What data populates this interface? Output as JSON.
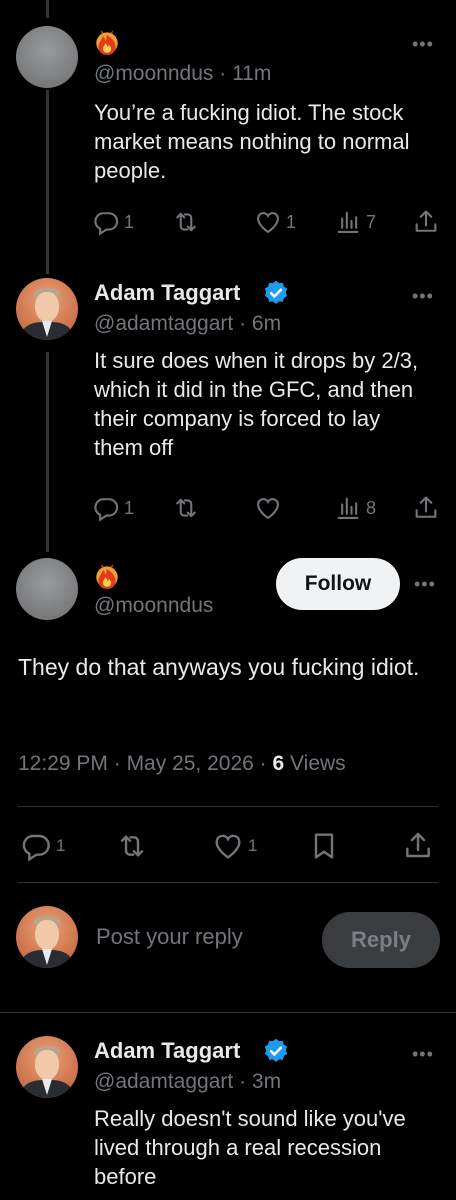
{
  "tweets": [
    {
      "handle": "@moonndus",
      "time": "11m",
      "text": "You’re a fucking idiot. The stock market means nothing to normal people.",
      "replies": "1",
      "retweets": "",
      "likes": "1",
      "views": "7"
    },
    {
      "name": "Adam Taggart",
      "handle": "@adamtaggart",
      "time": "6m",
      "text": "It sure does when it drops by 2/3, which it did in the GFC, and then their company is forced to lay them off",
      "replies": "1",
      "retweets": "",
      "likes": "",
      "views": "8"
    }
  ],
  "focus": {
    "handle": "@moonndus",
    "follow_label": "Follow",
    "text": "They do that anyways you fucking idiot.",
    "time": "12:29 PM",
    "date": "May 25, 2026",
    "views_count": "6",
    "views_label": "Views",
    "replies": "1",
    "likes": "1"
  },
  "composer": {
    "placeholder": "Post your reply",
    "reply_label": "Reply"
  },
  "reply": {
    "name": "Adam Taggart",
    "handle": "@adamtaggart",
    "time": "3m",
    "text": "Really doesn't sound like you've lived through a real recession before"
  },
  "colors": {
    "background": "#000000",
    "text": "#e7e9ea",
    "muted": "#71767b",
    "verified": "#1d9bf0",
    "follow_bg": "#eff3f4"
  },
  "icons": [
    "fire-icon",
    "verified-icon",
    "more-icon",
    "reply-icon",
    "retweet-icon",
    "like-icon",
    "views-icon",
    "share-icon",
    "bookmark-icon"
  ]
}
